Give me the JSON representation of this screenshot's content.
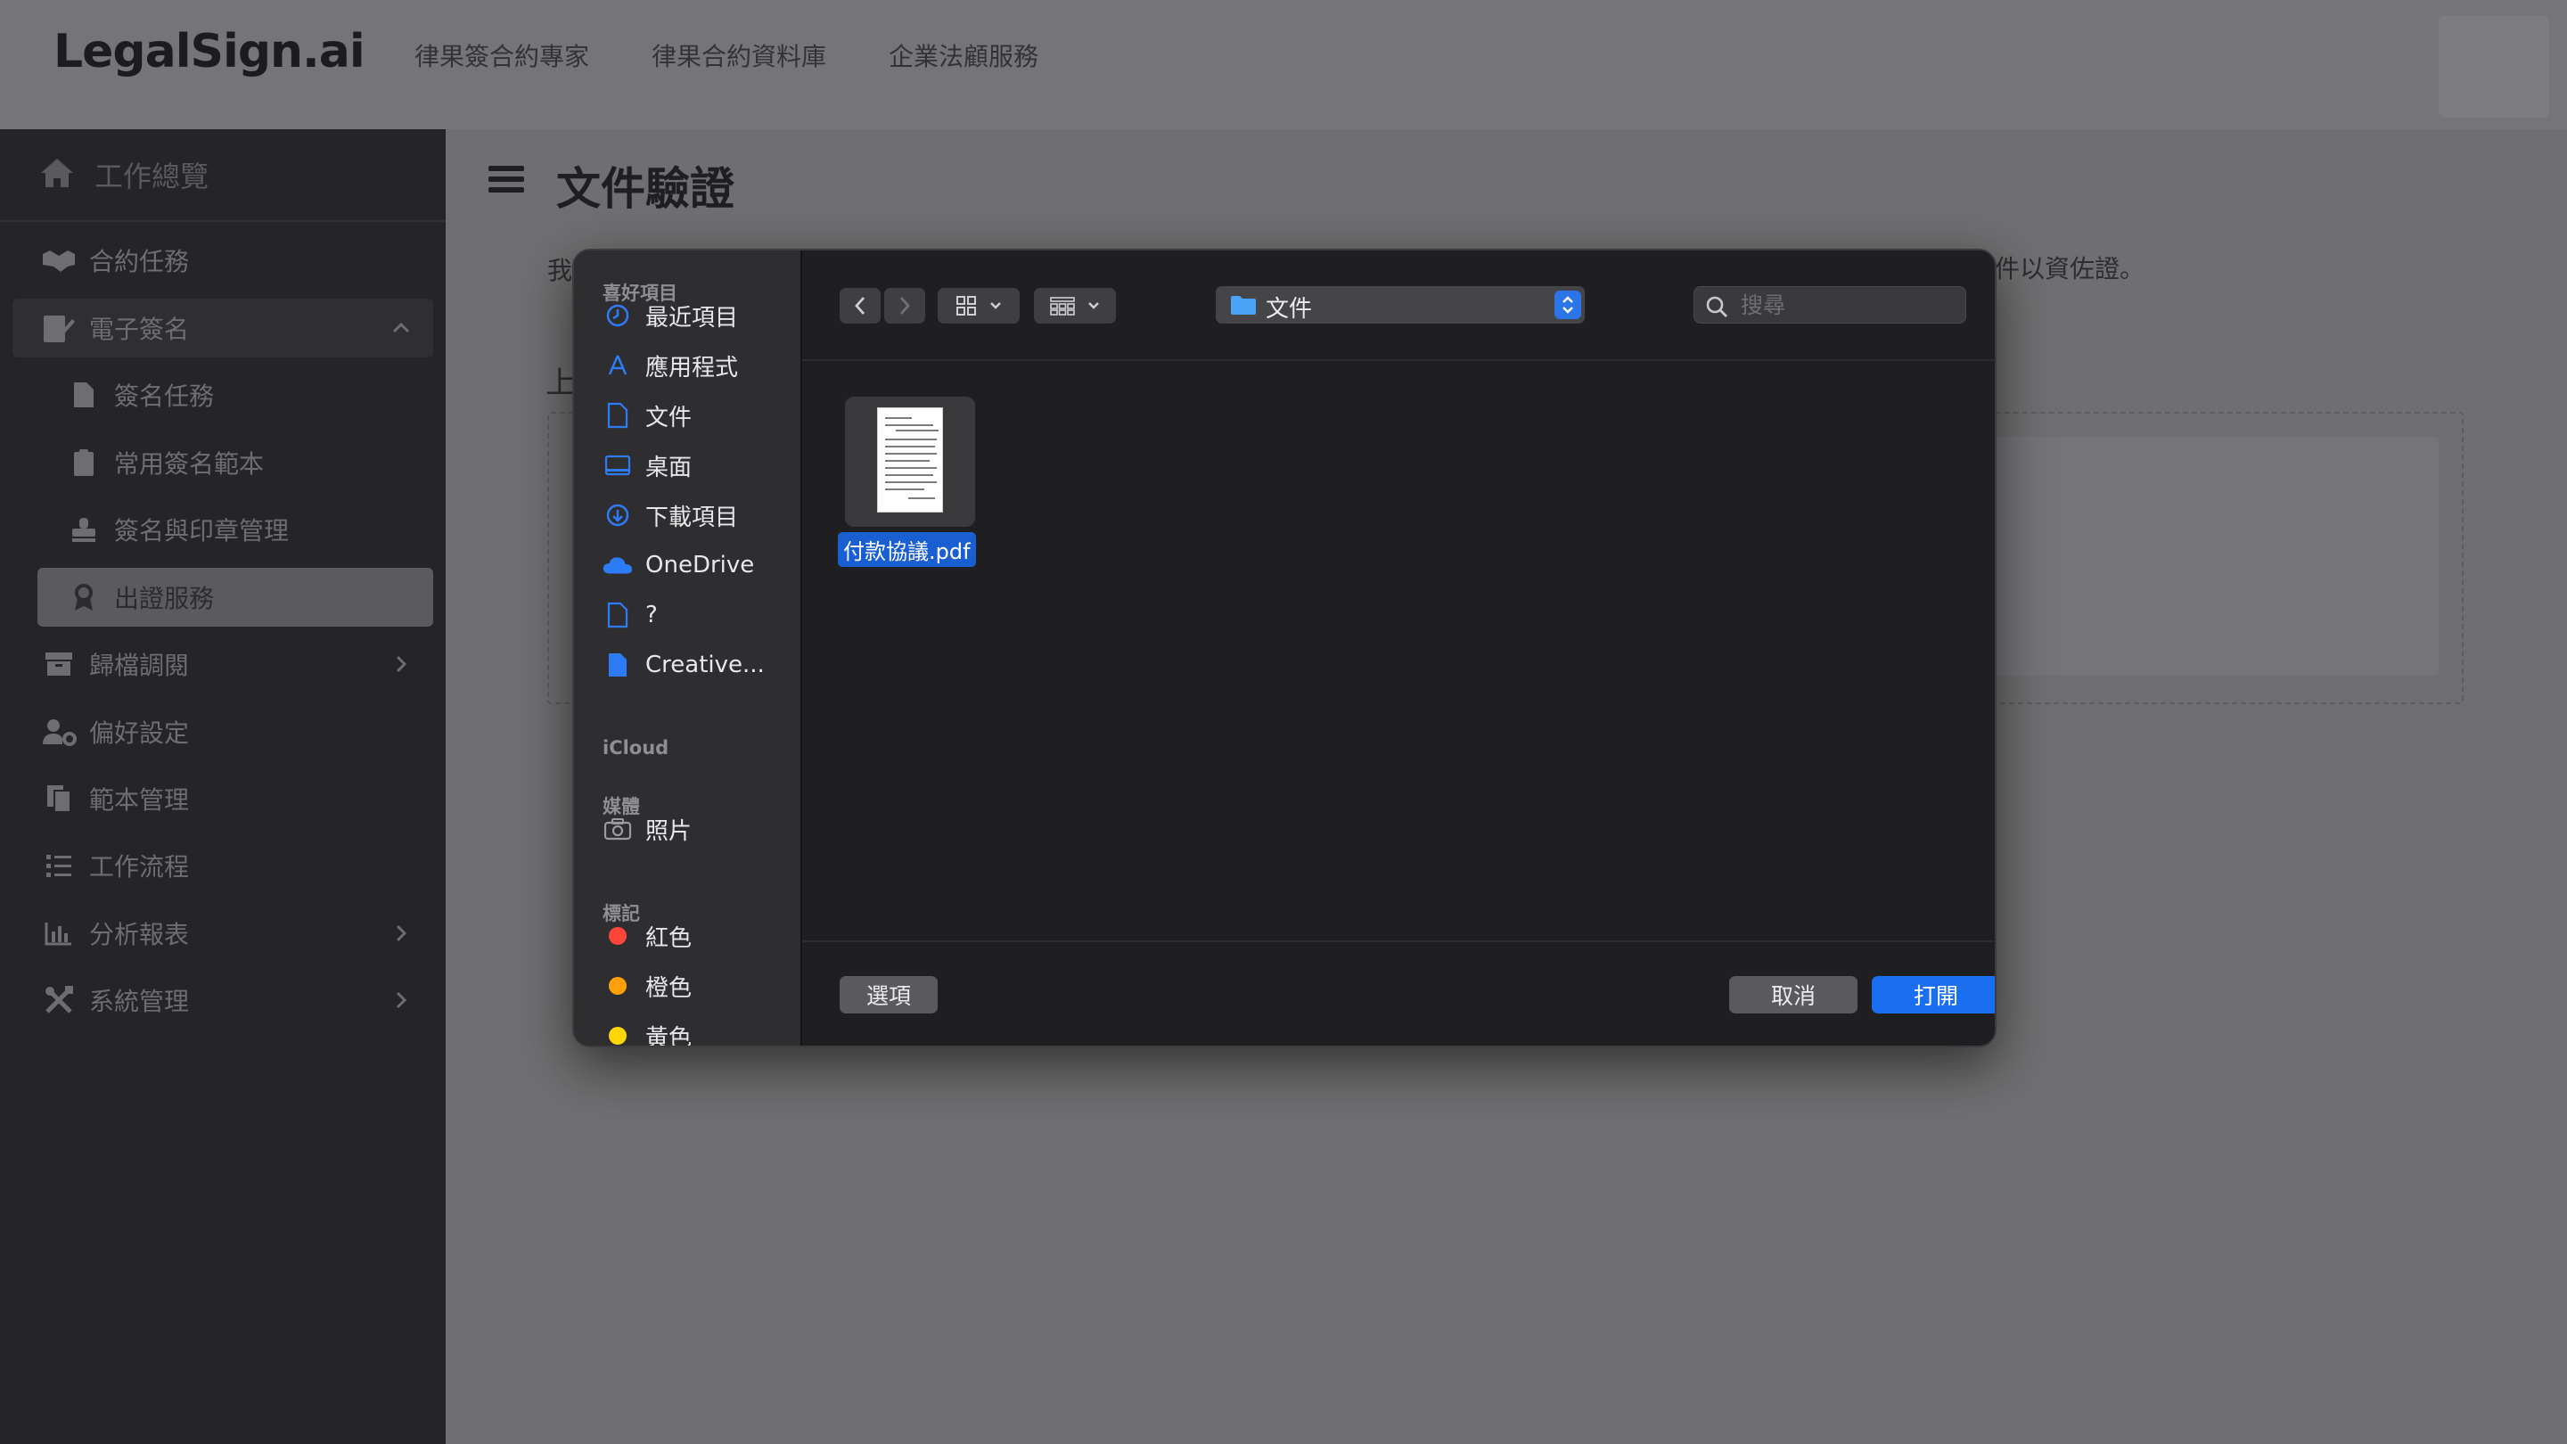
{
  "header": {
    "logo": "LegalSign.ai",
    "nav": [
      "律果簽合約專家",
      "律果合約資料庫",
      "企業法顧服務"
    ]
  },
  "sidebar": {
    "home": "工作總覽",
    "items": [
      {
        "label": "合約任務",
        "icon": "handshake-icon"
      },
      {
        "label": "電子簽名",
        "icon": "signature-icon"
      },
      {
        "label": "簽名任務",
        "icon": "document-icon"
      },
      {
        "label": "常用簽名範本",
        "icon": "clipboard-icon"
      },
      {
        "label": "簽名與印章管理",
        "icon": "stamp-icon"
      },
      {
        "label": "出證服務",
        "icon": "award-icon"
      },
      {
        "label": "歸檔調閱",
        "icon": "archive-icon"
      },
      {
        "label": "偏好設定",
        "icon": "user-gear-icon"
      },
      {
        "label": "範本管理",
        "icon": "files-icon"
      },
      {
        "label": "工作流程",
        "icon": "list-icon"
      },
      {
        "label": "分析報表",
        "icon": "bar-chart-icon"
      },
      {
        "label": "系統管理",
        "icon": "tools-icon"
      }
    ]
  },
  "main": {
    "title": "文件驗證",
    "desc_left": "我",
    "desc_right": "件以資佐證。",
    "upload_label": "上"
  },
  "dialog": {
    "sections": {
      "favorites": "喜好項目",
      "icloud": "iCloud",
      "media": "媒體",
      "tags": "標記"
    },
    "favorites": [
      "最近項目",
      "應用程式",
      "文件",
      "桌面",
      "下載項目",
      "OneDrive",
      "?",
      "Creative..."
    ],
    "media": [
      "照片"
    ],
    "tags": [
      {
        "label": "紅色",
        "color": "#ff453a"
      },
      {
        "label": "橙色",
        "color": "#ff9f0a"
      },
      {
        "label": "黃色",
        "color": "#ffd60a"
      }
    ],
    "current_folder": "文件",
    "search_placeholder": "搜尋",
    "files": [
      {
        "name": "付款協議.pdf"
      }
    ],
    "options_button": "選項",
    "cancel_button": "取消",
    "open_button": "打開"
  }
}
